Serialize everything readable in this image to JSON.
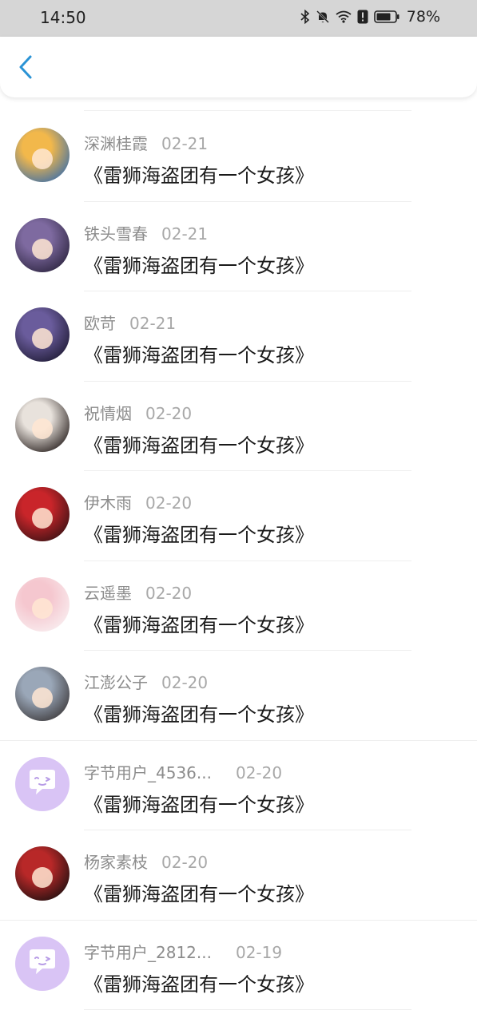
{
  "status_bar": {
    "time": "14:50",
    "battery": "78%",
    "icons": [
      "bluetooth-icon",
      "bell-muted-icon",
      "wifi-icon",
      "alert-icon",
      "battery-icon"
    ]
  },
  "nav": {
    "back_icon": "chevron-left-icon",
    "accent": "#2a93d5"
  },
  "items": [
    {
      "name": "深渊桂霞",
      "date": "02-21",
      "title": "《雷狮海盗团有一个女孩》",
      "avatar_colors": [
        "#f2b84b",
        "#3e6fa8"
      ]
    },
    {
      "name": "铁头雪春",
      "date": "02-21",
      "title": "《雷狮海盗团有一个女孩》",
      "avatar_colors": [
        "#7e6aa0",
        "#2d2540"
      ]
    },
    {
      "name": "欧苛",
      "date": "02-21",
      "title": "《雷狮海盗团有一个女孩》",
      "avatar_colors": [
        "#6a5c9c",
        "#1f1b35"
      ]
    },
    {
      "name": "祝情烟",
      "date": "02-20",
      "title": "《雷狮海盗团有一个女孩》",
      "avatar_colors": [
        "#e8e2dc",
        "#2a2220"
      ]
    },
    {
      "name": "伊木雨",
      "date": "02-20",
      "title": "《雷狮海盗团有一个女孩》",
      "avatar_colors": [
        "#c9252a",
        "#3a1214"
      ]
    },
    {
      "name": "云遥墨",
      "date": "02-20",
      "title": "《雷狮海盗团有一个女孩》",
      "avatar_colors": [
        "#f5c7cf",
        "#f9eef0"
      ]
    },
    {
      "name": "江澎公子",
      "date": "02-20",
      "title": "《雷狮海盗团有一个女孩》",
      "avatar_colors": [
        "#9aa7b8",
        "#3d3a3c"
      ]
    },
    {
      "name": "字节用户_4536...",
      "date": "02-20",
      "title": "《雷狮海盗团有一个女孩》",
      "avatar_colors": [
        "#d9c4f5",
        "#d9c4f5"
      ]
    },
    {
      "name": "杨家素枝",
      "date": "02-20",
      "title": "《雷狮海盗团有一个女孩》",
      "avatar_colors": [
        "#b82828",
        "#1e1010"
      ]
    },
    {
      "name": "字节用户_2812...",
      "date": "02-19",
      "title": "《雷狮海盗团有一个女孩》",
      "avatar_colors": [
        "#d9c4f5",
        "#d9c4f5"
      ]
    }
  ]
}
